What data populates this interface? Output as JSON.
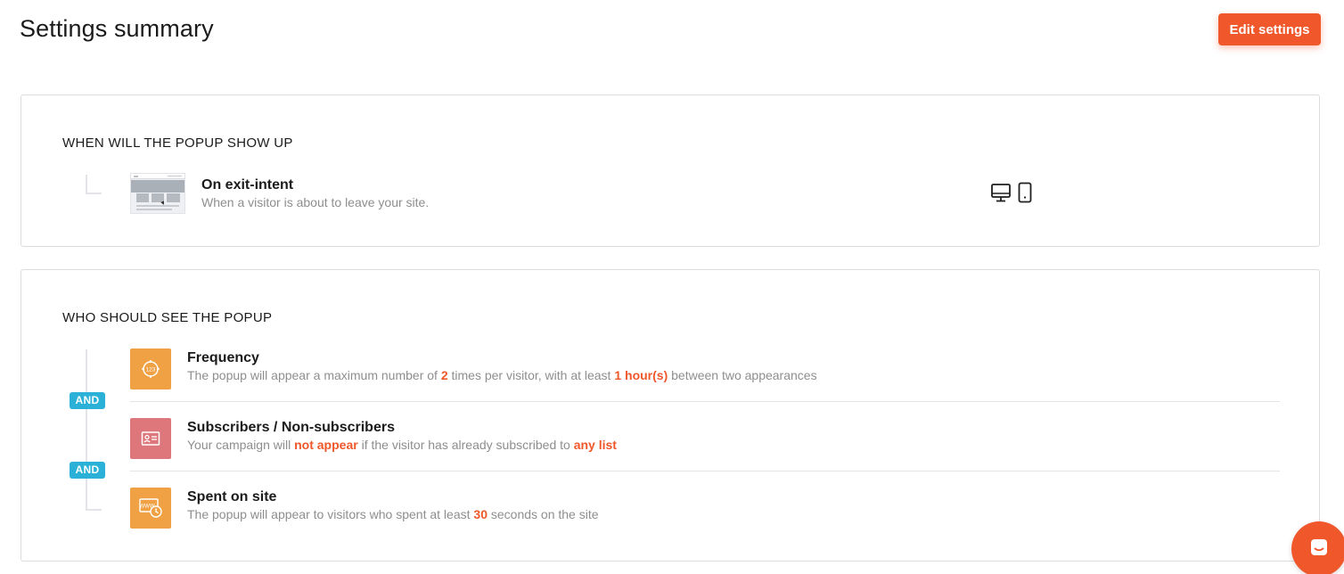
{
  "page": {
    "title": "Settings summary",
    "edit_label": "Edit settings"
  },
  "when_section": {
    "title": "WHEN WILL THE POPUP SHOW UP",
    "trigger": {
      "title": "On exit-intent",
      "description": "When a visitor is about to leave your site.",
      "devices": [
        "desktop-icon",
        "mobile-icon"
      ]
    }
  },
  "who_section": {
    "title": "WHO SHOULD SEE THE POPUP",
    "connector": "AND",
    "rules": [
      {
        "title": "Frequency",
        "icon": "frequency-icon",
        "desc_1": "The popup will appear a maximum number of ",
        "value_1": "2",
        "desc_2": " times per visitor, with at least ",
        "value_2": "1 hour(s)",
        "desc_3": " between two appearances"
      },
      {
        "title": "Subscribers / Non-subscribers",
        "icon": "contact-card-icon",
        "desc_1": "Your campaign will ",
        "value_1": "not appear",
        "desc_2": " if the visitor has already subscribed to ",
        "value_2": "any list"
      },
      {
        "title": "Spent on site",
        "icon": "time-on-site-icon",
        "desc_1": "The popup will appear to visitors who spent at least ",
        "value_1": "30",
        "desc_2": " seconds on the site"
      }
    ]
  },
  "colors": {
    "accent": "#f0572a",
    "and_badge": "#2bb1d8",
    "rule_orange": "#f0a144",
    "rule_pink": "#de777b"
  }
}
